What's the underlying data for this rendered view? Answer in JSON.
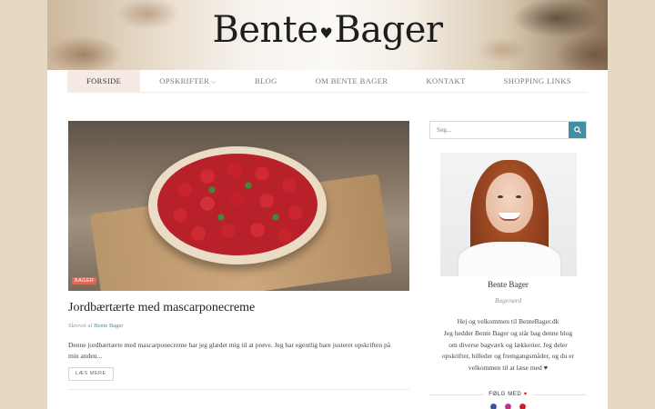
{
  "site": {
    "logo_left": "Bente",
    "logo_right": "Bager",
    "logo_heart": "♥"
  },
  "nav": {
    "items": [
      {
        "label": "FORSIDE",
        "active": true
      },
      {
        "label": "OPSKRIFTER",
        "has_dropdown": true
      },
      {
        "label": "BLOG"
      },
      {
        "label": "OM BENTE BAGER"
      },
      {
        "label": "KONTAKT"
      },
      {
        "label": "SHOPPING LINKS"
      }
    ],
    "dropdown_icon": "chevron-down-icon"
  },
  "post": {
    "category": "BAGER",
    "title": "Jordbærtærte med mascarponecreme",
    "meta_prefix": "Skrevet af",
    "author": "Bente Bager",
    "excerpt": "Denne jordbærtærte med mascarponecreme har jeg glædet mig til at prøve. Jeg har egentlig bare justeret opskriften på min anden...",
    "read_more": "LÆS MERE"
  },
  "sidebar": {
    "search_placeholder": "Søg...",
    "search_icon": "search-icon",
    "profile_name": "Bente Bager",
    "profile_role": "Bagenørd",
    "bio_lines": [
      "Hej og velkommen til BenteBager.dk",
      "Jeg hedder Bente Bager og står bag denne blog",
      "om diverse bagværk og lækkerier. Jeg deler",
      "opskrifter, billeder og fremgangsmåder, og du er",
      "velkommen til at læse med ♥"
    ],
    "follow_label": "FØLG MED",
    "follow_heart": "♥"
  },
  "colors": {
    "accent_teal": "#3f8fa6",
    "badge_coral": "#e26a53",
    "heart_red": "#c8232c",
    "page_bg": "#e6d9c3",
    "active_nav_bg": "#f6ebe4"
  }
}
